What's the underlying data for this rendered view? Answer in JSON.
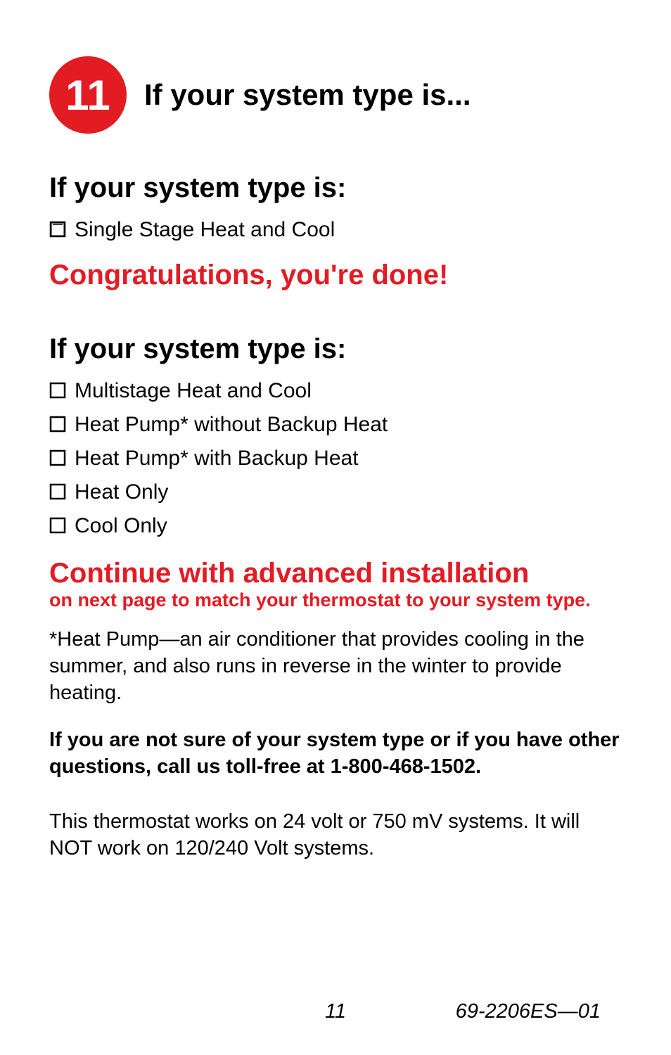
{
  "step": {
    "number": "11",
    "title": "If your system type is..."
  },
  "section1": {
    "heading": "If your system type is:",
    "items": [
      "Single Stage Heat and Cool"
    ],
    "congrats": "Congratulations, you're done!"
  },
  "section2": {
    "heading": "If your system type is:",
    "items": [
      "Multistage Heat and Cool",
      "Heat Pump* without Backup Heat",
      "Heat Pump* with Backup Heat",
      "Heat Only",
      "Cool Only"
    ],
    "continue_heading": "Continue with advanced installation",
    "continue_subtext": "on next page to match your thermostat to your system type.",
    "footnote": "*Heat Pump—an air conditioner that provides cooling in the summer, and also runs in reverse in the winter to provide heating.",
    "help_text": "If you are not sure of your system type or if you have other questions, call us toll-free at 1-800-468-1502.",
    "compat_text": "This thermostat works on 24 volt or 750 mV systems. It will NOT work on 120/240 Volt systems."
  },
  "footer": {
    "page_number": "11",
    "doc_id": "69-2206ES—01"
  }
}
